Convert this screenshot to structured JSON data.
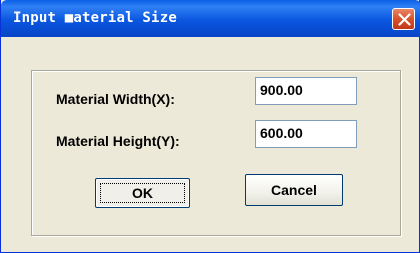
{
  "window": {
    "title": "Input ■aterial Size",
    "close_icon": "close-icon"
  },
  "form": {
    "width_label": "Material Width(X):",
    "width_value": "900.00",
    "height_label": "Material Height(Y):",
    "height_value": "600.00"
  },
  "buttons": {
    "ok_label": "OK",
    "cancel_label": "Cancel"
  },
  "colors": {
    "titlebar": "#0a5fe6",
    "close_button": "#d9512a",
    "dialog_background": "#ece9d8"
  }
}
